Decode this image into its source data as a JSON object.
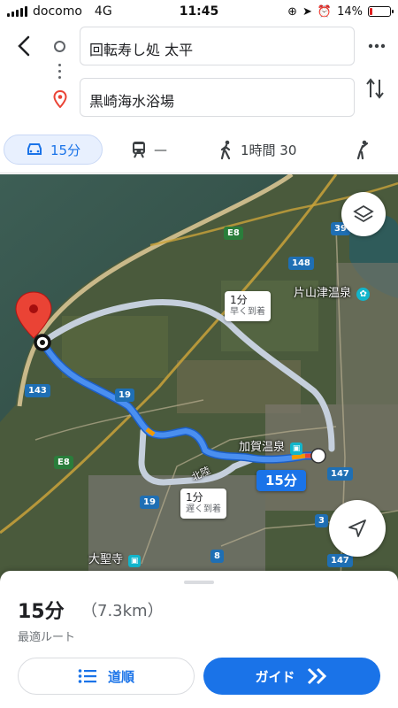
{
  "status_bar": {
    "carrier": "docomo",
    "network": "4G",
    "time": "11:45",
    "battery": "14%",
    "battery_level": 0.14
  },
  "search": {
    "origin_value": "回転寿し処 太平",
    "destination_value": "黒崎海水浴場",
    "icons": [
      "back-arrow-icon",
      "origin-circle-icon",
      "destination-pin-icon",
      "more-vert-icon",
      "swap-icon"
    ]
  },
  "modes": [
    {
      "icon": "car-icon",
      "label": "15分",
      "active": true
    },
    {
      "icon": "train-icon",
      "label": "—"
    },
    {
      "icon": "walk-icon",
      "label": "1時間 30"
    },
    {
      "icon": "ride-icon",
      "label": ""
    }
  ],
  "map": {
    "shields": [
      "E8",
      "39",
      "148",
      "19",
      "143",
      "E8",
      "147",
      "19",
      "8",
      "147",
      "3"
    ],
    "labels": {
      "onsen_north": "片山津温泉",
      "onsen_station": "加賀温泉",
      "daishoji": "大聖寺",
      "road": "北陸"
    },
    "callout_fast": {
      "time": "1分",
      "note": "早く到着"
    },
    "callout_slow": {
      "time": "1分",
      "note": "遅く到着"
    },
    "callout_main": "15分"
  },
  "sheet": {
    "duration": "15分",
    "distance": "（7.3km）",
    "route_label": "最適ルート",
    "steps_label": "道順",
    "guide_label": "ガイド"
  },
  "colors": {
    "accent": "#1a73e8",
    "route": "#4a8ff0",
    "alt_route": "#c5cfdc",
    "destination_pin": "#ea4335"
  }
}
